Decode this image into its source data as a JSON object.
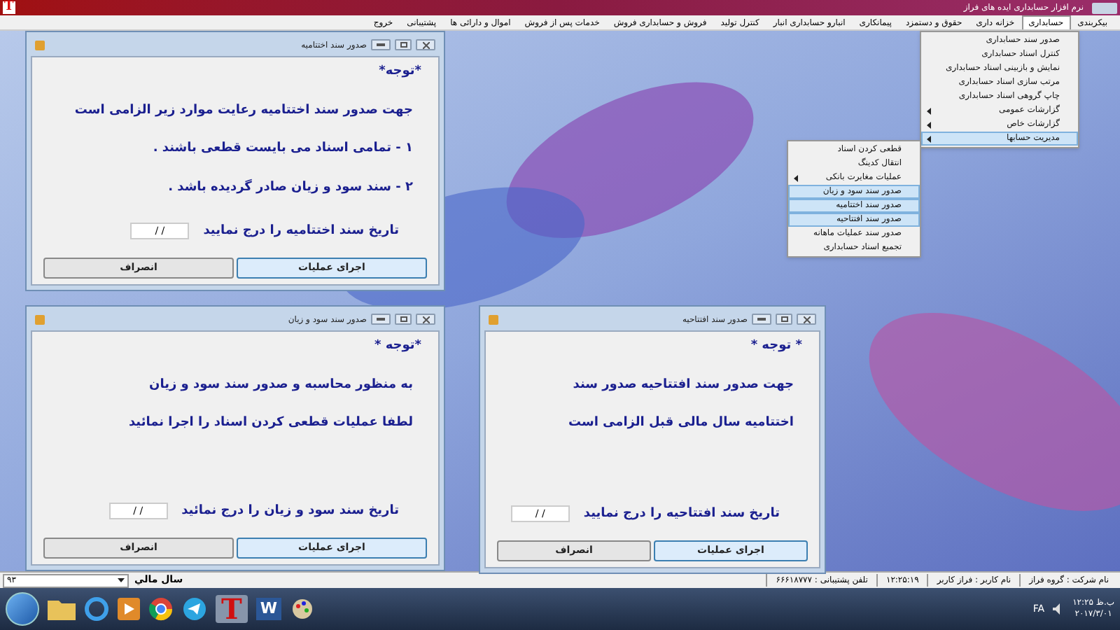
{
  "app": {
    "logo": "T",
    "title": "نرم افزار حسابداری ایده های فراز"
  },
  "menu_bar": [
    {
      "label": "بیکربندی",
      "selected": false
    },
    {
      "label": "حسابداری",
      "selected": true
    },
    {
      "label": "خزانه داری",
      "selected": false
    },
    {
      "label": "حقوق و دستمزد",
      "selected": false
    },
    {
      "label": "پیمانکاری",
      "selected": false
    },
    {
      "label": "انبارو حسابداری انبار",
      "selected": false
    },
    {
      "label": "کنترل تولید",
      "selected": false
    },
    {
      "label": "فروش و حسابداری فروش",
      "selected": false
    },
    {
      "label": "خدمات پس از فروش",
      "selected": false
    },
    {
      "label": "اموال و دارائی ها",
      "selected": false
    },
    {
      "label": "پشتیبانی",
      "selected": false
    },
    {
      "label": "خروج",
      "selected": false
    }
  ],
  "menus": [
    {
      "items": [
        {
          "label": "صدور سند حسابداری",
          "submenu": false,
          "highlighted": false
        },
        {
          "label": "کنترل اسناد حسابداری",
          "submenu": false,
          "highlighted": false
        },
        {
          "label": "نمایش و بازبینی اسناد حسابداری",
          "submenu": false,
          "highlighted": false
        },
        {
          "label": "مرتب سازی اسناد حسابداری",
          "submenu": false,
          "highlighted": false
        },
        {
          "label": "چاپ گروهی اسناد حسابداری",
          "submenu": false,
          "highlighted": false
        },
        {
          "label": "گزارشات عمومی",
          "submenu": true,
          "highlighted": false
        },
        {
          "label": "گزارشات خاص",
          "submenu": true,
          "highlighted": false
        },
        {
          "label": "مدیریت حسابها",
          "submenu": true,
          "highlighted": true
        }
      ]
    },
    {
      "items": [
        {
          "label": "قطعی کردن اسناد",
          "submenu": false,
          "highlighted": false
        },
        {
          "label": "انتقال کدینگ",
          "submenu": false,
          "highlighted": false
        },
        {
          "label": "عملیات مغایرت بانکی",
          "submenu": true,
          "highlighted": false
        },
        {
          "label": "صدور سند سود و زیان",
          "submenu": false,
          "highlighted": true
        },
        {
          "label": "صدور سند اختتامیه",
          "submenu": false,
          "highlighted": true
        },
        {
          "label": "صدور سند افتتاحیه",
          "submenu": false,
          "highlighted": true
        },
        {
          "label": "صدور سند عملیات ماهانه",
          "submenu": false,
          "highlighted": false
        },
        {
          "label": "تجمیع اسناد حسابداری",
          "submenu": false,
          "highlighted": false
        }
      ]
    }
  ],
  "windows": [
    {
      "title": "صدور سند اختتامیه",
      "lines": [
        "*توجه*",
        "جهت صدور سند اختتامیه رعایت موارد زیر الزامی است",
        "۱ - تمامی اسناد می بایست قطعی باشند .",
        "۲ - سند سود و زیان صادر گردیده باشد ."
      ],
      "date_label": "تاریخ سند اختتامیه را درج نمایید",
      "date_value": "/ /",
      "buttons": [
        {
          "label": "اجرای عملیات",
          "focused": true
        },
        {
          "label": "انصراف",
          "focused": false
        }
      ]
    },
    {
      "title": "صدور سند افتتاحیه",
      "lines": [
        "* توجه *",
        "جهت صدور سند افتتاحیه صدور سند",
        "اختتامیه سال مالی قبل الزامی است"
      ],
      "date_label": "تاریخ سند افتتاحیه را درج نمایید",
      "date_value": "/ /",
      "buttons": [
        {
          "label": "اجرای عملیات",
          "focused": true
        },
        {
          "label": "انصراف",
          "focused": false
        }
      ]
    },
    {
      "title": "صدور سند سود و زیان",
      "lines": [
        "*توجه *",
        "به منظور محاسبه و صدور سند سود و زیان",
        "لطفا عملیات قطعی کردن اسناد را اجرا نمائید"
      ],
      "date_label": "تاریخ سند سود و  زیان را درج نمائید",
      "date_value": "/ /",
      "buttons": [
        {
          "label": "اجرای عملیات",
          "focused": true
        },
        {
          "label": "انصراف",
          "focused": false
        }
      ]
    }
  ],
  "status_bar": {
    "year_value": "۹۳",
    "year_label": "سال مالي",
    "fields": [
      "نام شرکت : گروه فراز",
      "نام کاربر : فراز کاربر",
      "۱۲:۲۵:۱۹",
      "تلفن پشتیبانی : ۶۶۶۱۸۷۷۷"
    ]
  },
  "taskbar": {
    "app_logo": "T",
    "word_letter": "W",
    "language": "FA",
    "time": "۱۲:۲۵ ب.ظ",
    "date": "۲۰۱۷/۳/۰۱"
  }
}
